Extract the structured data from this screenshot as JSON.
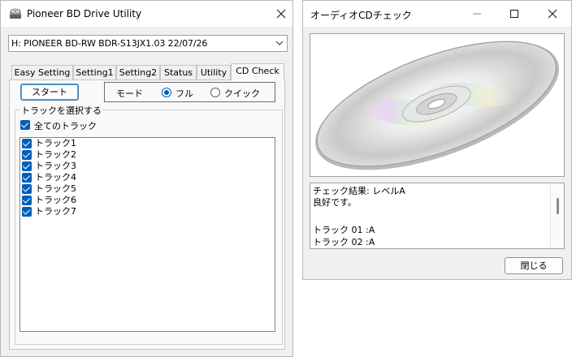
{
  "main_window": {
    "title": "Pioneer BD Drive Utility",
    "drive_select": "H: PIONEER BD-RW  BDR-S13JX1.03 22/07/26",
    "tabs": [
      {
        "label": "Easy Setting"
      },
      {
        "label": "Setting1"
      },
      {
        "label": "Setting2"
      },
      {
        "label": "Status"
      },
      {
        "label": "Utility"
      },
      {
        "label": "CD Check"
      }
    ],
    "start_button": "スタート",
    "mode_label": "モード",
    "mode_full": "フル",
    "mode_quick": "クイック",
    "mode_selected": "フル",
    "group_title": "トラックを選択する",
    "all_tracks": "全てのトラック",
    "all_tracks_checked": true,
    "tracks": [
      {
        "label": "トラック1",
        "checked": true
      },
      {
        "label": "トラック2",
        "checked": true
      },
      {
        "label": "トラック3",
        "checked": true
      },
      {
        "label": "トラック4",
        "checked": true
      },
      {
        "label": "トラック5",
        "checked": true
      },
      {
        "label": "トラック6",
        "checked": true
      },
      {
        "label": "トラック7",
        "checked": true
      }
    ]
  },
  "check_window": {
    "title": "オーディオCDチェック",
    "result_lines": [
      "チェック結果: レベルA",
      "良好です。",
      "",
      "トラック 01    :A",
      "トラック 02    :A"
    ],
    "close_button": "閉じる"
  },
  "colors": {
    "accent": "#005fb8",
    "window_bg": "#f0f0f0",
    "panel_bg": "#f9f9f9"
  }
}
